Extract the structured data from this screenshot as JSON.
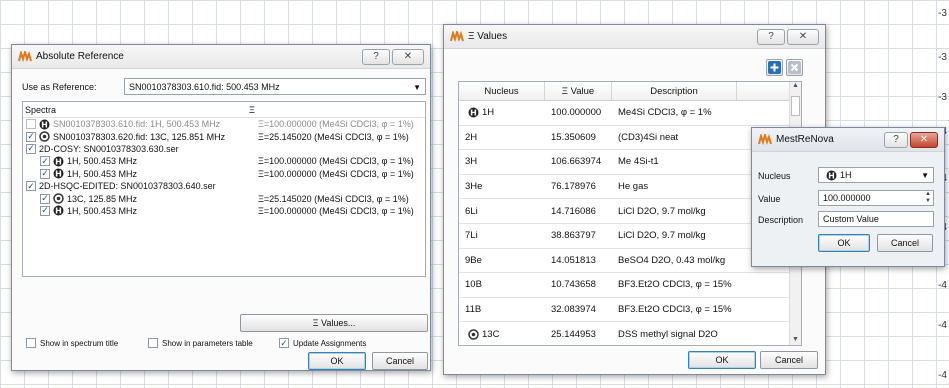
{
  "axis": {
    "ticks": [
      "-3",
      "-3",
      "-3",
      "-4",
      "-4",
      "-4",
      "-4",
      "-4",
      "-4"
    ]
  },
  "absolute_reference": {
    "title": "Absolute Reference",
    "use_as_reference_label": "Use as Reference:",
    "reference_value": "SN0010378303.610.fid: 500.453 MHz",
    "columns": {
      "spectra": "Spectra",
      "xi": "Ξ"
    },
    "rows": [
      {
        "name": "SN0010378303.610.fid: 1H, 500.453 MHz",
        "xi": "Ξ=100.000000 (Me4Si CDCl3, φ = 1%)",
        "checked": false,
        "disabled": true,
        "icon": "proton-nucleus-icon",
        "indent": 0
      },
      {
        "name": "SN0010378303.620.fid: 13C, 125.851 MHz",
        "xi": "Ξ=25.145020 (Me4Si CDCl3, φ = 1%)",
        "checked": true,
        "disabled": false,
        "icon": "carbon-nucleus-icon",
        "indent": 0
      },
      {
        "name": "2D-COSY: SN0010378303.630.ser",
        "xi": "",
        "checked": true,
        "disabled": false,
        "icon": "",
        "indent": 0
      },
      {
        "name": "1H, 500.453 MHz",
        "xi": "Ξ=100.000000 (Me4Si CDCl3, φ = 1%)",
        "checked": true,
        "disabled": false,
        "icon": "proton-nucleus-icon",
        "indent": 1
      },
      {
        "name": "1H, 500.453 MHz",
        "xi": "Ξ=100.000000 (Me4Si CDCl3, φ = 1%)",
        "checked": true,
        "disabled": false,
        "icon": "proton-nucleus-icon",
        "indent": 1
      },
      {
        "name": "2D-HSQC-EDITED: SN0010378303.640.ser",
        "xi": "",
        "checked": true,
        "disabled": false,
        "icon": "",
        "indent": 0
      },
      {
        "name": "13C, 125.85 MHz",
        "xi": "Ξ=25.145020 (Me4Si CDCl3, φ = 1%)",
        "checked": true,
        "disabled": false,
        "icon": "carbon-nucleus-icon",
        "indent": 1
      },
      {
        "name": "1H, 500.453 MHz",
        "xi": "Ξ=100.000000 (Me4Si CDCl3, φ = 1%)",
        "checked": true,
        "disabled": false,
        "icon": "proton-nucleus-icon",
        "indent": 1
      }
    ],
    "xi_values_button": "Ξ Values...",
    "show_in_spectrum_title": {
      "label": "Show in spectrum title",
      "checked": false
    },
    "show_in_parameters_table": {
      "label": "Show in parameters table",
      "checked": false
    },
    "update_assignments": {
      "label": "Update Assignments",
      "checked": true
    },
    "ok": "OK",
    "cancel": "Cancel"
  },
  "xi_values": {
    "title": "Ξ Values",
    "columns": {
      "nucleus": "Nucleus",
      "value": "Ξ Value",
      "description": "Description"
    },
    "rows": [
      {
        "nucleus": "1H",
        "value": "100.000000",
        "description": "Me4Si CDCl3, φ = 1%",
        "icon": true
      },
      {
        "nucleus": "2H",
        "value": "15.350609",
        "description": "(CD3)4Si neat",
        "icon": false
      },
      {
        "nucleus": "3H",
        "value": "106.663974",
        "description": "Me 4Si-t1",
        "icon": false
      },
      {
        "nucleus": "3He",
        "value": "76.178976",
        "description": "He gas",
        "icon": false
      },
      {
        "nucleus": "6Li",
        "value": "14.716086",
        "description": "LiCl D2O, 9.7 mol/kg",
        "icon": false
      },
      {
        "nucleus": "7Li",
        "value": "38.863797",
        "description": "LiCl D2O, 9.7 mol/kg",
        "icon": false
      },
      {
        "nucleus": "9Be",
        "value": "14.051813",
        "description": "BeSO4 D2O, 0.43 mol/kg",
        "icon": false
      },
      {
        "nucleus": "10B",
        "value": "10.743658",
        "description": "BF3.Et2O CDCl3, φ = 15%",
        "icon": false
      },
      {
        "nucleus": "11B",
        "value": "32.083974",
        "description": "BF3.Et2O CDCl3, φ = 15%",
        "icon": false
      },
      {
        "nucleus": "13C",
        "value": "25.144953",
        "description": "DSS methyl signal D2O",
        "icon": true
      }
    ],
    "ok": "OK",
    "cancel": "Cancel"
  },
  "mestrenova": {
    "title": "MestReNova",
    "nucleus_label": "Nucleus",
    "nucleus_value": "1H",
    "value_label": "Value",
    "value": "100.000000",
    "description_label": "Description",
    "description": "Custom Value",
    "ok": "OK",
    "cancel": "Cancel"
  },
  "colors": {
    "accent": "#2a6fb5",
    "close_red": "#c9442e",
    "grid": "#d8dde8"
  }
}
